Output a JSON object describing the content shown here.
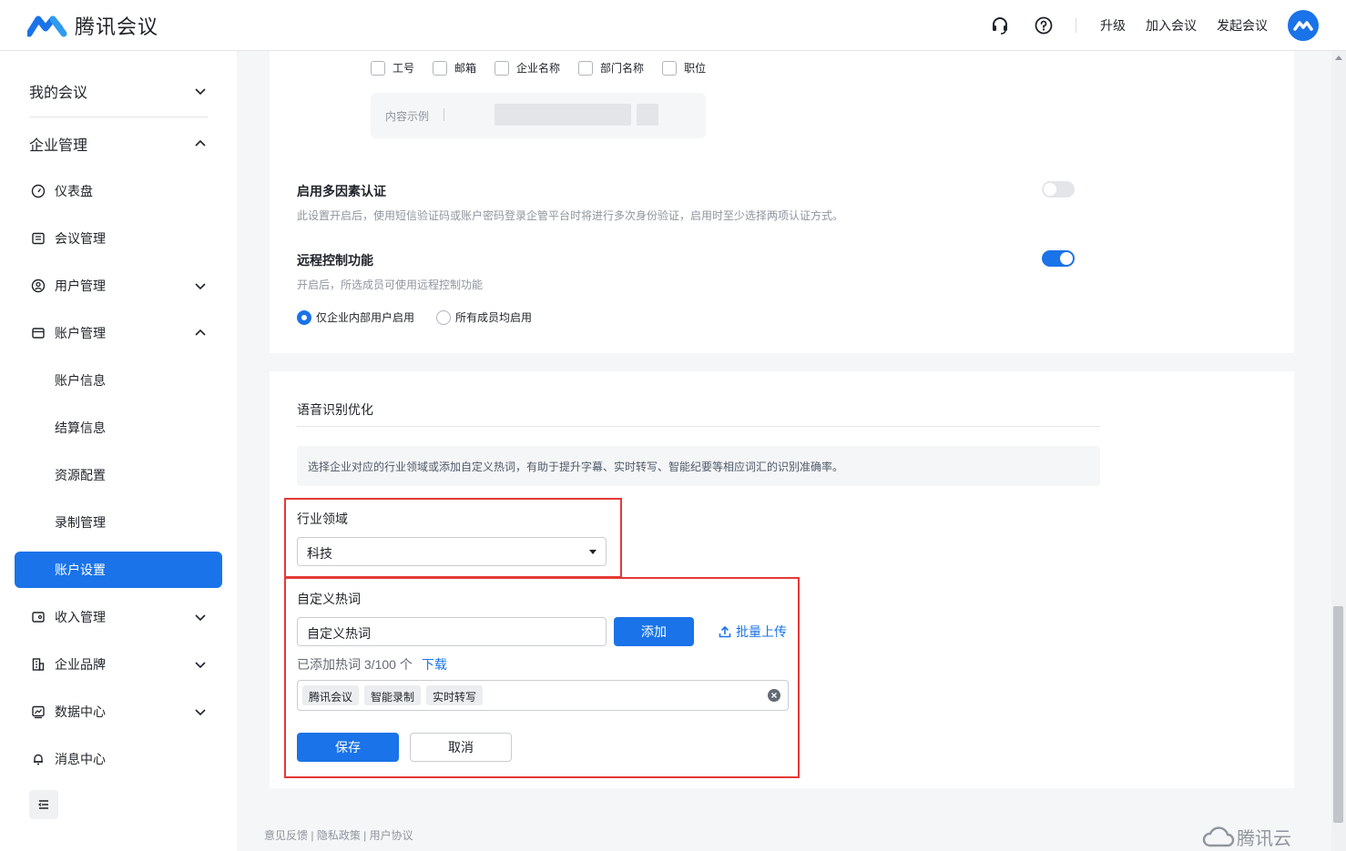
{
  "app": {
    "name": "腾讯会议"
  },
  "header": {
    "upgrade": "升级",
    "join_meeting": "加入会议",
    "start_meeting": "发起会议"
  },
  "sidebar": {
    "my_meetings": "我的会议",
    "enterprise_mgmt": "企业管理",
    "items": [
      {
        "label": "仪表盘"
      },
      {
        "label": "会议管理"
      },
      {
        "label": "用户管理"
      },
      {
        "label": "账户管理"
      }
    ],
    "sub_items": [
      {
        "label": "账户信息"
      },
      {
        "label": "结算信息"
      },
      {
        "label": "资源配置"
      },
      {
        "label": "录制管理"
      },
      {
        "label": "账户设置",
        "active": true
      }
    ],
    "items2": [
      {
        "label": "收入管理"
      },
      {
        "label": "企业品牌"
      },
      {
        "label": "数据中心"
      },
      {
        "label": "消息中心"
      }
    ]
  },
  "watermark_options": {
    "checkboxes": [
      "工号",
      "邮箱",
      "企业名称",
      "部门名称",
      "职位"
    ],
    "example_label": "内容示例"
  },
  "mfa": {
    "title": "启用多因素认证",
    "desc": "此设置开启后，使用短信验证码或账户密码登录企管平台时将进行多次身份验证，启用时至少选择两项认证方式。",
    "enabled": false
  },
  "remote_control": {
    "title": "远程控制功能",
    "desc": "开启后，所选成员可使用远程控制功能",
    "enabled": true,
    "options": [
      "仅企业内部用户启用",
      "所有成员均启用"
    ],
    "selected": 0
  },
  "speech": {
    "title": "语音识别优化",
    "info": "选择企业对应的行业领域或添加自定义热词，有助于提升字幕、实时转写、智能纪要等相应词汇的识别准确率。",
    "industry_label": "行业领域",
    "industry_value": "科技",
    "hotword_label": "自定义热词",
    "hotword_input": "自定义热词",
    "add_button": "添加",
    "batch_upload": "批量上传",
    "count_text": "已添加热词 3/100 个",
    "download": "下载",
    "tags": [
      "腾讯会议",
      "智能录制",
      "实时转写"
    ],
    "save": "保存",
    "cancel": "取消"
  },
  "footer": {
    "feedback": "意见反馈",
    "privacy": "隐私政策",
    "agreement": "用户协议",
    "cloud": "腾讯云"
  },
  "colors": {
    "accent": "#1a73e8",
    "highlight": "#e53935"
  }
}
